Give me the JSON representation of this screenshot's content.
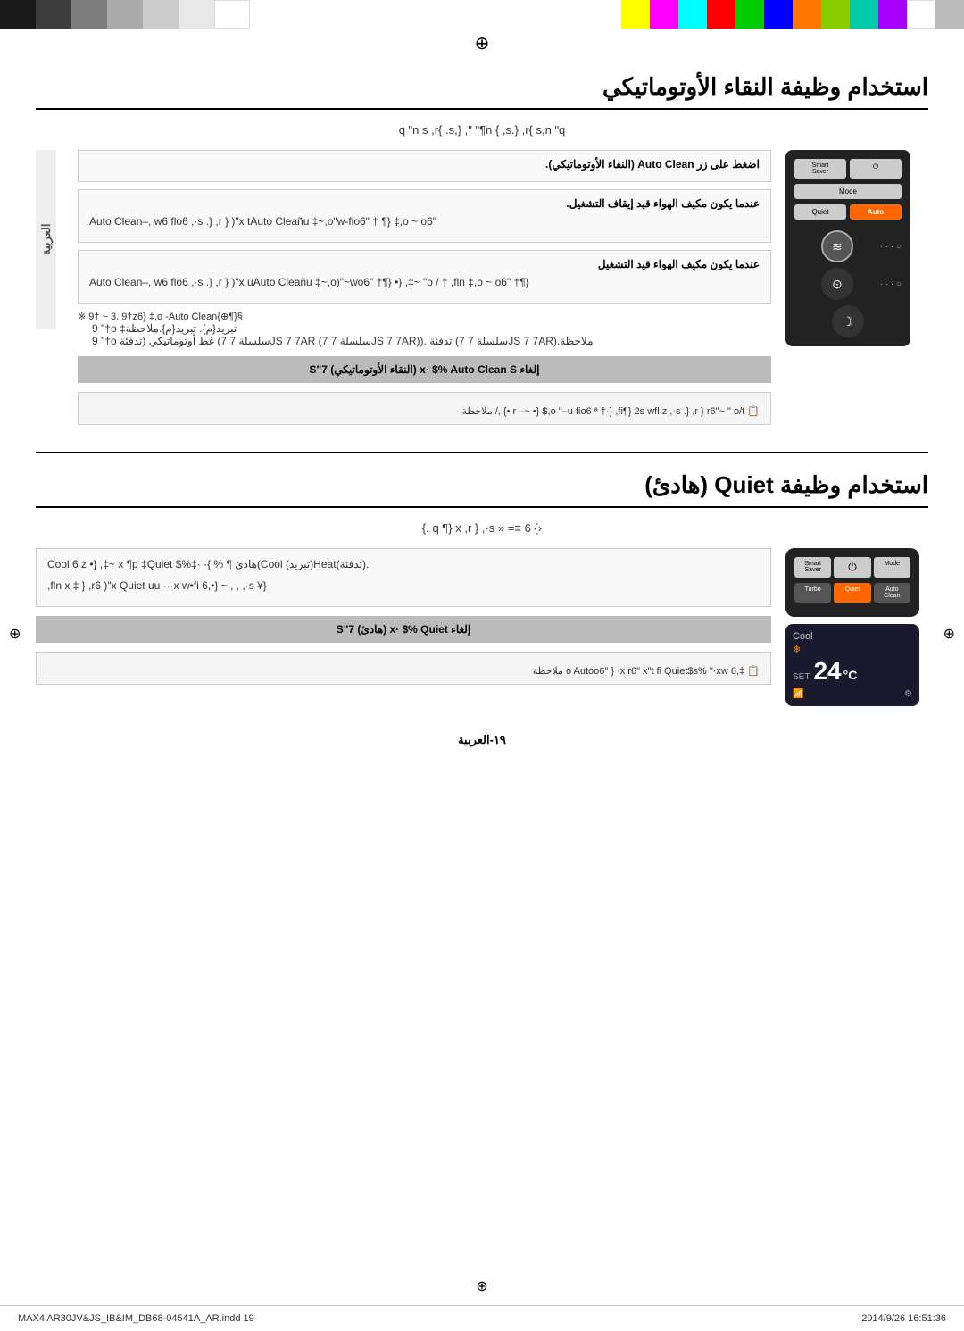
{
  "topBar": {
    "graySwatches": [
      "#1a1a1a",
      "#3d3d3d",
      "#5e5e5e",
      "#7d7d7d",
      "#999",
      "#b5b5b5",
      "#d0d0d0",
      "#e8e8e8",
      "#fff"
    ],
    "colorSwatches": [
      "#ffff00",
      "#ff00ff",
      "#00ffff",
      "#ff0000",
      "#00ff00",
      "#0000ff",
      "#ff8800",
      "#88ff00",
      "#00ffaa",
      "#aa00ff",
      "#ffffff",
      "#cccccc"
    ]
  },
  "section1": {
    "title": "استخدام وظيفة النقاء الأوتوماتيكي",
    "subtitle": "q \"n s ,r{ .s,} ,\" \"¶n { ,s.} ,r{ s,n \"q",
    "arabicLabel": "العربية",
    "step1Title": "اضغط على زر Auto Clean (النقاء الأوتوماتيكي).",
    "step2Title": "عندما يكون مكيف الهواء قيد إيقاف التشغيل.",
    "step2Text": "Auto Clean–, w6   flo6   ,·s .}   ,r }  )\"x   tAuto Cleañu ‡~,o\"w-fio6\"   † ¶}   ‡,o ~ o6\"",
    "step3Title": "عندما يكون مكيف الهواء قيد التشغيل",
    "step3Text": "Auto Clean–, w6   flo6   ,·s .}   ,r }  )\"x   uAuto Cleañu ‡~,o)\"~wo6\"   †¶}   •}   ,‡~   \"o / †   ,fln   ‡,o ~ o6\"   †¶}",
    "noteLabel1": "※",
    "noteText1": "9†  ~ 3.   9†z6}  ‡,o -Auto Clean{⊕¶}§",
    "noteText1b": "9  \"†o  ‡تبريد{م}.  تبريد{م}.ملاحظة",
    "noteText1c": "9  \"†o  غط أوتوماتيكي (تدفئة (سلسلة 7 7JS 7 7AR (سلسلة 7 7JS 7 7AR)). تدفئة (سلسلة 7 7JS 7 7AR).ملاحظة",
    "cancelBoxText": "إلغاء  x·  $%  Auto Clean S (النقاء الأوتوماتيكي) 7\"S",
    "cancelNote": "r –~   •}  $,o  \"–u  fio6  ª  †·}   ,fi¶}  2s  wfl z   ,·s .}   ,r }   r6\"~  \"  o/t   •}   ,/   ملاحظة",
    "remoteButtons": {
      "smartSaver": "Smart\nSaver",
      "power": "⏻",
      "mode": "Mode",
      "quietLabel": "Quiet",
      "autoLabel": "Auto",
      "autoHighlighted": true
    },
    "remoteIcons": {
      "fan": "≋",
      "timer": "⊙",
      "sleep": "☽"
    }
  },
  "section2": {
    "title": "استخدام وظيفة Quiet (هادئ)",
    "subtitle": "‹}  6 ≡= «  q ¶}  x  ,r }  ,·s .}",
    "arabicLabel": "العربية",
    "mainText1": "Cool  6  z  •}   ,‡~   x   ¶p ‡Quiet $%‡·  ·{   %   ¶ هادئ(Cool (تبريد)Heat(تدفئة).",
    "mainText2": ",fln  x  ‡  }   ,r6  )\"x Quiet uu ···x  w•fi   6,•}  ~  , ,  ,·s ¥}",
    "cancelBoxText2": "إلغاء  x·  $%  Quiet (هادئ) S\"7",
    "noteText2": "‡,o Autoo6\"  }   ·x  r6\"   x\"t  fi  Quiet$s%  \"·xw  6   ملاحظة",
    "displayMode": "Cool",
    "displaySet": "SET",
    "displayTemp": "24",
    "displayDegree": "°C",
    "remoteButtons2": {
      "smartSaver": "Smart\nSaver",
      "power": "⏻",
      "mode": "Mode",
      "turbo": "Turbo",
      "quiet": "Quiet",
      "autoClean": "Auto\nClean"
    }
  },
  "footer": {
    "filename": "MAX4 AR30JV&JS_IB&IM_DB68-04541A_AR.indd   19",
    "pageNumber": "١٩-العربية",
    "timestamp": "2014/9/26   16:51:36"
  }
}
